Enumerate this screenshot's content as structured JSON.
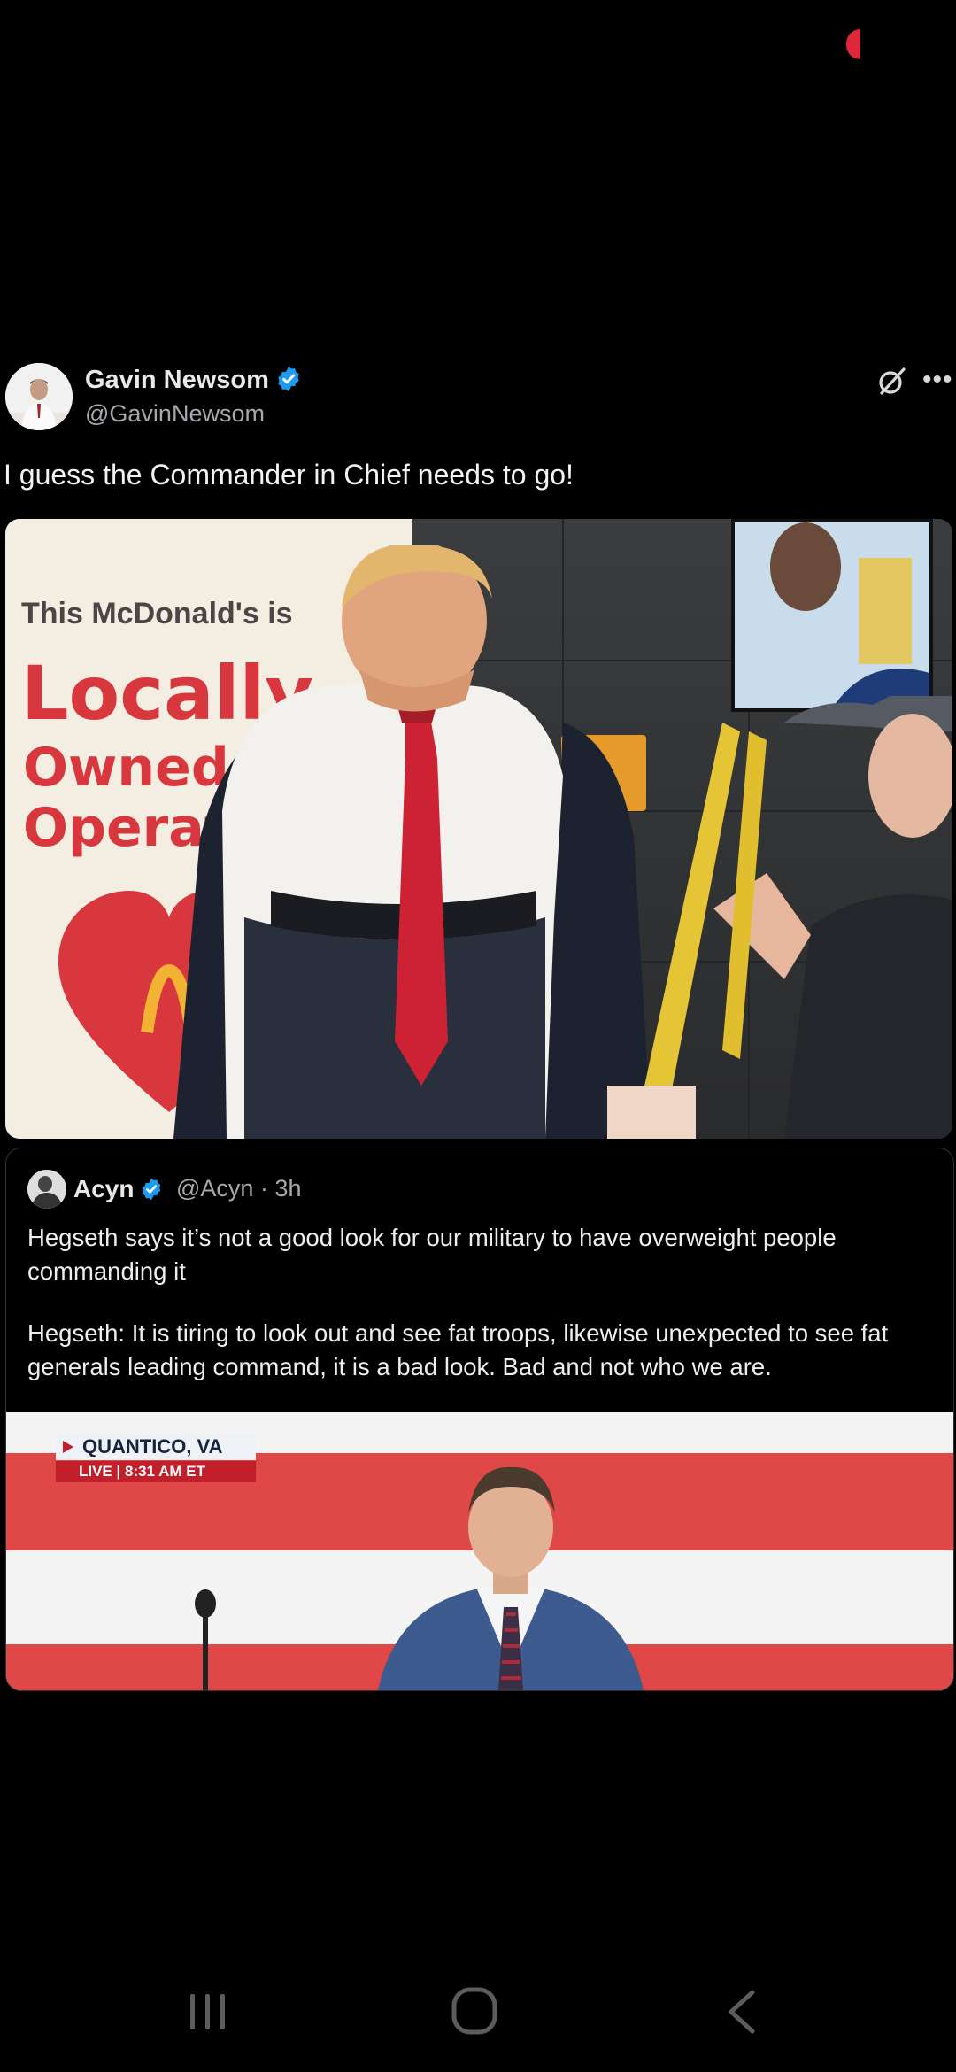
{
  "post": {
    "author_name": "Gavin Newsom",
    "author_handle": "@GavinNewsom",
    "text": "I guess the Commander in Chief needs to go!",
    "more_icon": "•••",
    "photo": {
      "sign_line1": "This McDonald's is",
      "sign_line2": "Locally",
      "sign_line3": "Owned a",
      "sign_line4": "Operat"
    }
  },
  "quoted": {
    "author_name": "Acyn",
    "author_handle": "@Acyn",
    "time": "3h",
    "meta": "@Acyn · 3h",
    "text1": "Hegseth says it’s not a good look for our military to have overweight people commanding it",
    "text2": "Hegseth: It is tiring to look out and see fat troops, likewise unexpected to see fat generals leading command, it is a bad look. Bad and not who we are.",
    "media": {
      "location": "QUANTICO, VA",
      "live": "LIVE",
      "time": "8:31 AM ET",
      "live_line": "LIVE  |  8:31 AM ET"
    }
  },
  "colors": {
    "background": "#000000",
    "verified": "#1d9bf0",
    "text": "#e7e9ea",
    "secondary": "#a5a9ad"
  },
  "icons": [
    "verified-badge-icon",
    "grok-icon",
    "more-icon",
    "recent-apps-icon",
    "home-icon",
    "back-icon"
  ]
}
